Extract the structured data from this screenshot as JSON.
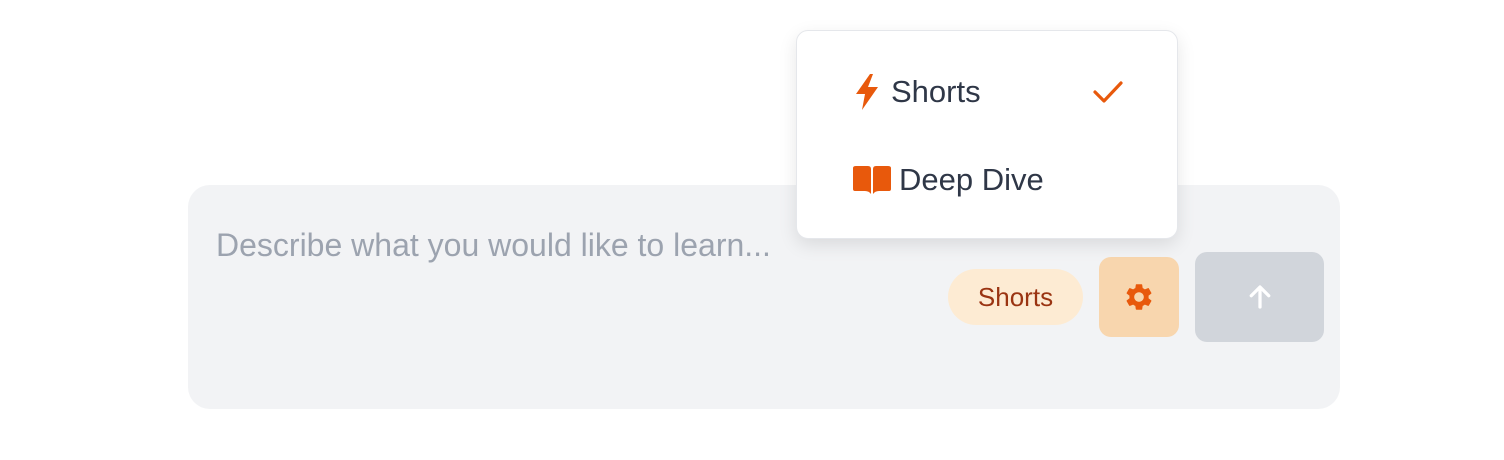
{
  "composer": {
    "placeholder": "Describe what you would like to learn...",
    "value": "",
    "mode_pill_label": "Shorts",
    "settings_icon": "gear-icon",
    "submit_icon": "arrow-up-icon"
  },
  "mode_menu": {
    "items": [
      {
        "label": "Shorts",
        "icon": "lightning-bolt-icon",
        "selected": true
      },
      {
        "label": "Deep Dive",
        "icon": "open-book-icon",
        "selected": false
      }
    ],
    "selected_indicator_icon": "checkmark-icon"
  },
  "colors": {
    "accent": "#e8590c",
    "pill_bg": "#fdebd3",
    "pill_text": "#9a3412",
    "settings_bg": "#f8d6ae",
    "submit_bg": "#d1d5db",
    "composer_bg": "#f2f3f5",
    "menu_text": "#2f3747",
    "placeholder_text": "#9ca3af"
  }
}
